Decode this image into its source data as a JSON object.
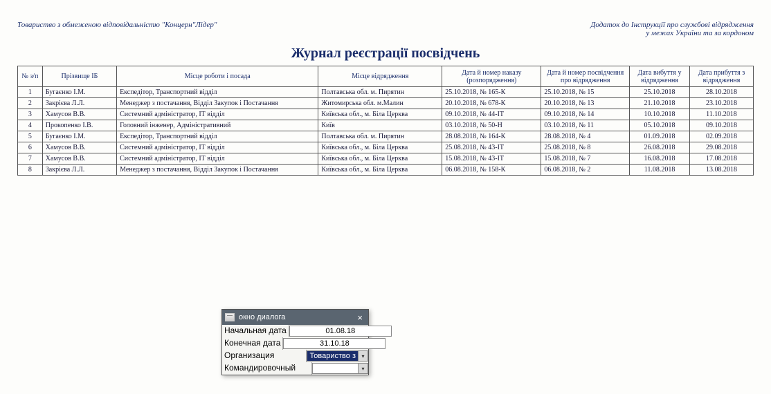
{
  "header": {
    "org_full_left": "Товариство з обмеженою відповідальністю \"Концерн\"Лідер\"",
    "right_line1": "Додаток до Інструкції про службові відрядження",
    "right_line2": "у межах України та за кордоном",
    "title": "Журнал реєстрації посвідчень"
  },
  "columns": {
    "num": "№ з/п",
    "name": "Прізвище ІБ",
    "work": "Місце роботи і посада",
    "place": "Місце відрядження",
    "order": "Дата й номер наказу (розпорядження)",
    "cert": "Дата й номер посвідчення про відрядження",
    "departure": "Дата вибуття у відрядження",
    "arrival": "Дата прибуття з відрядження"
  },
  "rows": [
    {
      "n": "1",
      "name": "Бугаєнко І.М.",
      "work": "Експедітор,  Транспортний відділ",
      "place": "Полтавська обл. м. Пирятин",
      "order": "25.10.2018, № 165-К",
      "cert": "25.10.2018, № 15",
      "dep": "25.10.2018",
      "arr": "28.10.2018"
    },
    {
      "n": "2",
      "name": "Закрієва Л.Л.",
      "work": "Менеджер з постачання,  Відділ Закупок і Постачання",
      "place": "Житомирська обл. м.Малин",
      "order": "20.10.2018, № 678-К",
      "cert": "20.10.2018, № 13",
      "dep": "21.10.2018",
      "arr": "23.10.2018"
    },
    {
      "n": "3",
      "name": "Хамусов В.В.",
      "work": "Системний адміністратор,  ІТ відділ",
      "place": "Київська обл., м. Біла Церква",
      "order": "09.10.2018, № 44-ІТ",
      "cert": "09.10.2018, № 14",
      "dep": "10.10.2018",
      "arr": "11.10.2018"
    },
    {
      "n": "4",
      "name": "Прокопенко І.В.",
      "work": "Головний інженер,  Адміністративний",
      "place": "Київ",
      "order": "03.10.2018, № 50-Н",
      "cert": "03.10.2018, № 11",
      "dep": "05.10.2018",
      "arr": "09.10.2018"
    },
    {
      "n": "5",
      "name": "Бугаєнко І.М.",
      "work": "Експедітор,  Транспортний відділ",
      "place": "Полтавська обл. м. Пирятин",
      "order": "28.08.2018, № 164-К",
      "cert": "28.08.2018, № 4",
      "dep": "01.09.2018",
      "arr": "02.09.2018"
    },
    {
      "n": "6",
      "name": "Хамусов В.В.",
      "work": "Системний адміністратор,  ІТ відділ",
      "place": "Київська обл., м. Біла Церква",
      "order": "25.08.2018, № 43-ІТ",
      "cert": "25.08.2018, № 8",
      "dep": "26.08.2018",
      "arr": "29.08.2018"
    },
    {
      "n": "7",
      "name": "Хамусов В.В.",
      "work": "Системний адміністратор,  ІТ відділ",
      "place": "Київська обл., м. Біла Церква",
      "order": "15.08.2018, № 43-ІТ",
      "cert": "15.08.2018, № 7",
      "dep": "16.08.2018",
      "arr": "17.08.2018"
    },
    {
      "n": "8",
      "name": "Закрієва Л.Л.",
      "work": "Менеджер з постачання,  Відділ Закупок і Постачання",
      "place": "Київська обл., м. Біла Церква",
      "order": "06.08.2018, № 158-К",
      "cert": "06.08.2018, № 2",
      "dep": "11.08.2018",
      "arr": "13.08.2018"
    }
  ],
  "dialog": {
    "title": "окно диалога",
    "labels": {
      "start_date": "Начальная дата",
      "end_date": "Конечная дата",
      "org": "Организация",
      "person": "Командировочный"
    },
    "values": {
      "start_date": "01.08.18",
      "end_date": "31.10.18",
      "org": "Товариство з",
      "person": ""
    }
  }
}
